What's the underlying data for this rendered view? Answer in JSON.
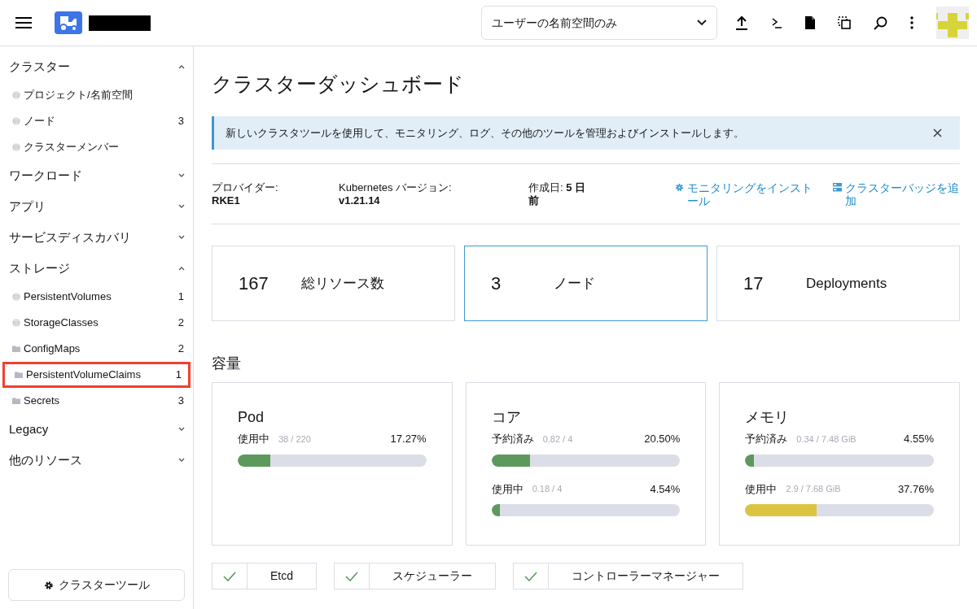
{
  "header": {
    "namespace_filter": "ユーザーの名前空間のみ"
  },
  "sidebar": {
    "groups": [
      {
        "label": "クラスター",
        "expanded": true,
        "items": [
          {
            "label": "プロジェクト/名前空間",
            "kind": "globe",
            "highlighted": false
          },
          {
            "label": "ノード",
            "kind": "globe",
            "count": "3",
            "highlighted": false
          },
          {
            "label": "クラスターメンバー",
            "kind": "globe",
            "highlighted": false
          }
        ]
      },
      {
        "label": "ワークロード",
        "expanded": false
      },
      {
        "label": "アプリ",
        "expanded": false
      },
      {
        "label": "サービスディスカバリ",
        "expanded": false
      },
      {
        "label": "ストレージ",
        "expanded": true,
        "items": [
          {
            "label": "PersistentVolumes",
            "kind": "globe",
            "count": "1",
            "highlighted": false
          },
          {
            "label": "StorageClasses",
            "kind": "globe",
            "count": "2",
            "highlighted": false
          },
          {
            "label": "ConfigMaps",
            "kind": "folder",
            "count": "2",
            "highlighted": false
          },
          {
            "label": "PersistentVolumeClaims",
            "kind": "folder",
            "count": "1",
            "highlighted": true
          },
          {
            "label": "Secrets",
            "kind": "folder",
            "count": "3",
            "highlighted": false
          }
        ]
      },
      {
        "label": "Legacy",
        "expanded": false
      },
      {
        "label": "他のリソース",
        "expanded": false
      }
    ],
    "cluster_tools_button": "クラスターツール"
  },
  "main": {
    "title": "クラスターダッシュボード",
    "banner": "新しいクラスタツールを使用して、モニタリング、ログ、その他のツールを管理およびインストールします。",
    "info": [
      {
        "label": "プロバイダー:",
        "value": "RKE1"
      },
      {
        "label": "Kubernetes バージョン:",
        "value": "v1.21.14"
      },
      {
        "label": "作成日:",
        "value": "5 日前"
      }
    ],
    "links": [
      {
        "kind": "gear",
        "label": "モニタリングをインストール"
      },
      {
        "kind": "badge",
        "label": "クラスターバッジを追加"
      }
    ],
    "stats": [
      {
        "count": "167",
        "label": "総リソース数",
        "selected": false
      },
      {
        "count": "3",
        "label": "ノード",
        "selected": true
      },
      {
        "count": "17",
        "label": "Deployments",
        "selected": false
      }
    ],
    "capacity_title": "容量",
    "capacity": [
      {
        "title": "Pod",
        "meters": [
          {
            "label": "使用中",
            "detail": "38 / 220",
            "percent": "17.27%",
            "level": 0.1727,
            "color": "#5d995d"
          }
        ]
      },
      {
        "title": "コア",
        "meters": [
          {
            "label": "予約済み",
            "detail": "0.82 / 4",
            "percent": "20.50%",
            "level": 0.205,
            "color": "#5d995d"
          },
          {
            "label": "使用中",
            "detail": "0.18 / 4",
            "percent": "4.54%",
            "level": 0.0454,
            "color": "#5d995d"
          }
        ]
      },
      {
        "title": "メモリ",
        "meters": [
          {
            "label": "予約済み",
            "detail": "0.34 / 7.48 GiB",
            "percent": "4.55%",
            "level": 0.0455,
            "color": "#5d995d"
          },
          {
            "label": "使用中",
            "detail": "2.9 / 7.68 GiB",
            "percent": "37.76%",
            "level": 0.3776,
            "color": "#dcc443"
          }
        ]
      }
    ],
    "components": [
      {
        "label": "Etcd",
        "healthy": true
      },
      {
        "label": "スケジューラー",
        "healthy": true
      },
      {
        "label": "コントローラーマネージャー",
        "healthy": true
      }
    ]
  }
}
